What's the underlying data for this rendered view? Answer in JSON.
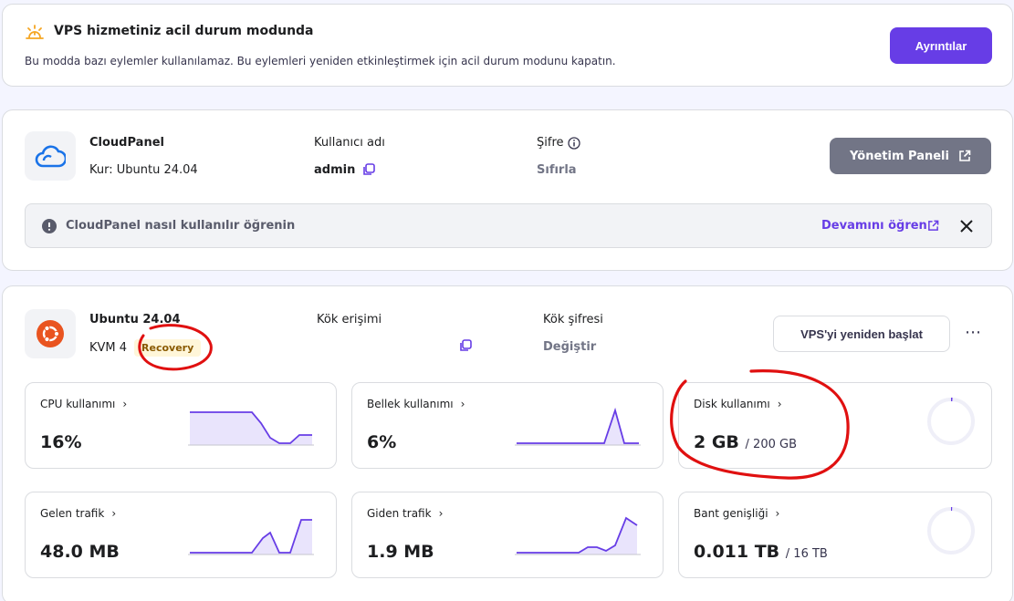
{
  "alert": {
    "title": "VPS hizmetiniz acil durum modunda",
    "description": "Bu modda bazı eylemler kullanılamaz. Bu eylemleri yeniden etkinleştirmek için acil durum modunu kapatın.",
    "button": "Ayrıntılar",
    "icon": "warning-sun-icon",
    "icon_color": "#f5a623"
  },
  "cloudpanel": {
    "name": "CloudPanel",
    "install": "Kur: Ubuntu 24.04",
    "username_label": "Kullanıcı adı",
    "username": "admin",
    "password_label": "Şifre",
    "password_action": "Sıfırla",
    "panel_button": "Yönetim Paneli",
    "info_text": "CloudPanel nasıl kullanılır öğrenin",
    "learn_more": "Devamını öğren"
  },
  "vps": {
    "os": "Ubuntu 24.04",
    "plan": "KVM 4",
    "badge": "Recovery",
    "root_access_label": "Kök erişimi",
    "root_password_label": "Kök şifresi",
    "root_password_action": "Değiştir",
    "restart_button": "VPS'yi yeniden başlat",
    "more": "⋯"
  },
  "stats": {
    "cpu": {
      "label": "CPU kullanımı",
      "value": "16%"
    },
    "memory": {
      "label": "Bellek kullanımı",
      "value": "6%"
    },
    "disk": {
      "label": "Disk kullanımı",
      "value": "2 GB",
      "total": "/ 200 GB",
      "fraction": 0.01
    },
    "incoming": {
      "label": "Gelen trafik",
      "value": "48.0 MB"
    },
    "outgoing": {
      "label": "Giden trafik",
      "value": "1.9 MB"
    },
    "bandwidth": {
      "label": "Bant genişliği",
      "value": "0.011 TB",
      "total": "/ 16 TB",
      "fraction": 0.0007
    }
  },
  "colors": {
    "accent": "#673de6",
    "annotation_red": "#e01010"
  }
}
